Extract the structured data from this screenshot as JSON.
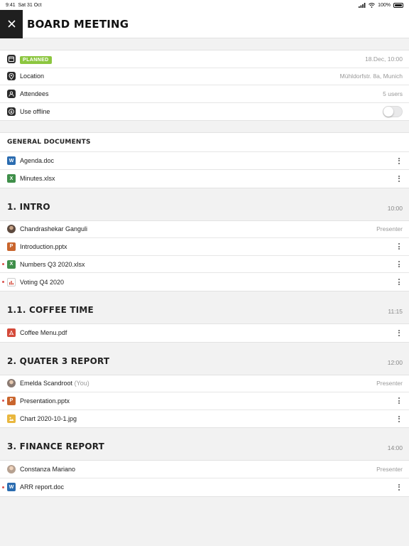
{
  "status_bar": {
    "time": "9:41",
    "date": "Sat 31 Oct",
    "battery": "100%"
  },
  "header": {
    "title": "BOARD MEETING"
  },
  "info": {
    "status_badge": "PLANNED",
    "datetime": "18.Dec, 10:00",
    "location_label": "Location",
    "location_value": "Mühldorfstr. 8a, Munich",
    "attendees_label": "Attendees",
    "attendees_value": "5 users",
    "offline_label": "Use offline",
    "offline_enabled": false
  },
  "general_documents": {
    "title": "GENERAL DOCUMENTS",
    "items": [
      {
        "name": "Agenda.doc",
        "type": "word",
        "letter": "W"
      },
      {
        "name": "Minutes.xlsx",
        "type": "excel",
        "letter": "X"
      }
    ]
  },
  "sections": [
    {
      "title": "1. INTRO",
      "time": "10:00",
      "presenter": {
        "name": "Chandrashekar Ganguli",
        "role": "Presenter"
      },
      "items": [
        {
          "name": "Introduction.pptx",
          "type": "ppt",
          "letter": "P",
          "unread": false
        },
        {
          "name": "Numbers Q3 2020.xlsx",
          "type": "excel",
          "letter": "X",
          "unread": true
        },
        {
          "name": "Voting Q4 2020",
          "type": "chart",
          "letter": "",
          "unread": true
        }
      ]
    },
    {
      "title": "1.1. COFFEE TIME",
      "time": "11:15",
      "items": [
        {
          "name": "Coffee Menu.pdf",
          "type": "pdf",
          "letter": "",
          "unread": false
        }
      ]
    },
    {
      "title": "2. QUATER 3 REPORT",
      "time": "12:00",
      "presenter": {
        "name": "Emelda Scandroot",
        "suffix": "(You)",
        "role": "Presenter"
      },
      "items": [
        {
          "name": "Presentation.pptx",
          "type": "ppt",
          "letter": "P",
          "unread": true
        },
        {
          "name": "Chart 2020-10-1.jpg",
          "type": "img",
          "letter": "",
          "unread": false
        }
      ]
    },
    {
      "title": "3. FINANCE REPORT",
      "time": "14:00",
      "presenter": {
        "name": "Constanza Mariano",
        "role": "Presenter"
      },
      "items": [
        {
          "name": "ARR report.doc",
          "type": "word",
          "letter": "W",
          "unread": true
        }
      ]
    }
  ]
}
